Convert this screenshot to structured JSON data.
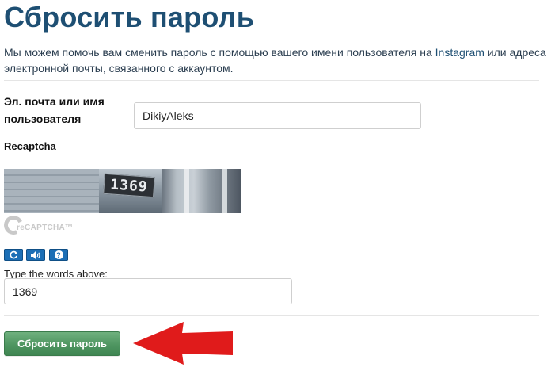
{
  "page": {
    "title": "Сбросить пароль",
    "description_part1": "Мы можем помочь вам сменить пароль с помощью вашего имени пользователя на ",
    "description_brand": "Instagram",
    "description_part2": " или адреса электронной почты, связанного с аккаунтом."
  },
  "form": {
    "username_label": "Эл. почта или имя пользователя",
    "username_value": "DikiyAleks",
    "recaptcha_label": "Recaptcha",
    "captcha_image_text": "1369",
    "recaptcha_logo_text": "reCAPTCHA™",
    "type_words_label": "Type the words above:",
    "captcha_answer_value": "1369",
    "submit_label": "Сбросить пароль"
  },
  "captcha_controls": {
    "refresh_icon": "refresh-icon",
    "audio_icon": "speaker-icon",
    "help_icon": "help-icon",
    "help_glyph": "?"
  },
  "colors": {
    "title": "#1e4f73",
    "control_blue": "#1c6fb6",
    "submit_green": "#4f9661",
    "annotation_arrow": "#e01b1b"
  }
}
